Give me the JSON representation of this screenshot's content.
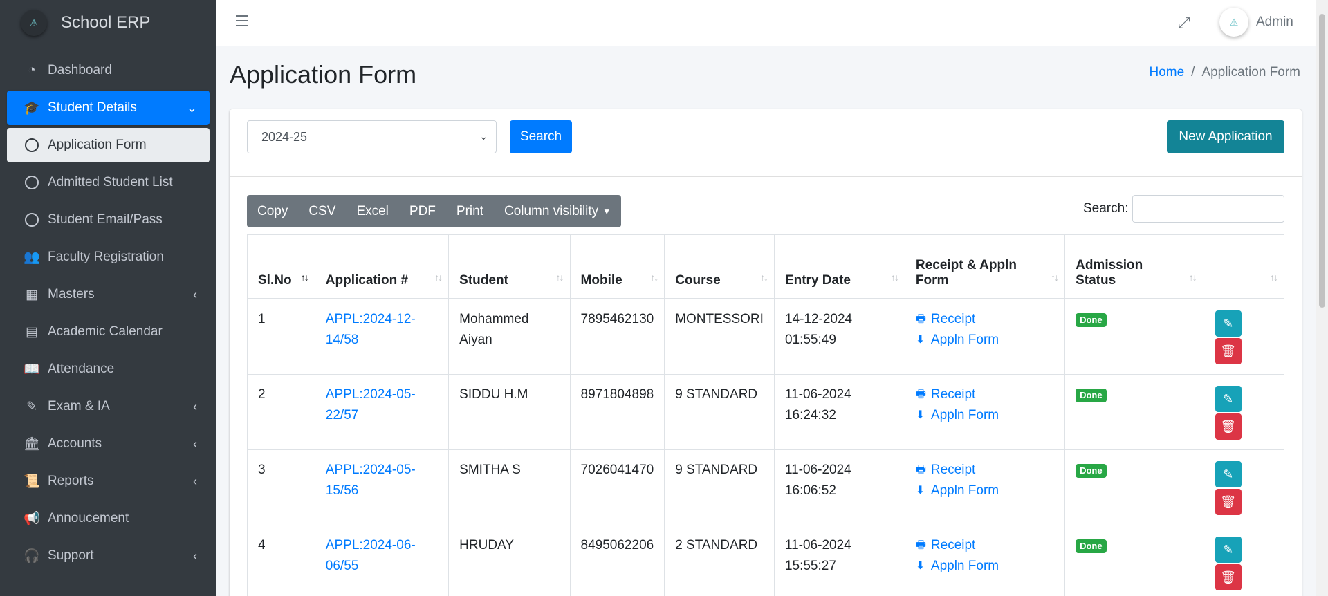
{
  "brand": {
    "name": "School ERP",
    "logo_icon": "school-logo-icon"
  },
  "sidebar": {
    "items": [
      {
        "label": "Dashboard",
        "icon": "dashboard-icon",
        "glyph": "◔",
        "state": "normal",
        "arrow": ""
      },
      {
        "label": "Student Details",
        "icon": "graduation-cap-icon",
        "glyph": "🎓",
        "state": "active",
        "arrow": "⌄"
      },
      {
        "label": "Application Form",
        "icon": "circle-icon",
        "glyph": "",
        "state": "sub-active",
        "arrow": ""
      },
      {
        "label": "Admitted Student List",
        "icon": "circle-icon",
        "glyph": "",
        "state": "sub",
        "arrow": ""
      },
      {
        "label": "Student Email/Pass",
        "icon": "circle-icon",
        "glyph": "",
        "state": "sub",
        "arrow": ""
      },
      {
        "label": "Faculty Registration",
        "icon": "users-icon",
        "glyph": "👥",
        "state": "normal",
        "arrow": ""
      },
      {
        "label": "Masters",
        "icon": "grid-icon",
        "glyph": "▦",
        "state": "normal",
        "arrow": "‹"
      },
      {
        "label": "Academic Calendar",
        "icon": "calendar-icon",
        "glyph": "▤",
        "state": "normal",
        "arrow": ""
      },
      {
        "label": "Attendance",
        "icon": "book-icon",
        "glyph": "📖",
        "state": "normal",
        "arrow": ""
      },
      {
        "label": "Exam & IA",
        "icon": "pencil-icon",
        "glyph": "✎",
        "state": "normal",
        "arrow": "‹"
      },
      {
        "label": "Accounts",
        "icon": "bank-icon",
        "glyph": "🏛",
        "state": "normal",
        "arrow": "‹"
      },
      {
        "label": "Reports",
        "icon": "scroll-icon",
        "glyph": "📜",
        "state": "normal",
        "arrow": "‹"
      },
      {
        "label": "Annoucement",
        "icon": "megaphone-icon",
        "glyph": "📢",
        "state": "normal",
        "arrow": ""
      },
      {
        "label": "Support",
        "icon": "headset-icon",
        "glyph": "🎧",
        "state": "normal",
        "arrow": "‹"
      }
    ]
  },
  "topbar": {
    "user_name": "Admin"
  },
  "page": {
    "title": "Application Form",
    "breadcrumb": {
      "home": "Home",
      "current": "Application Form"
    }
  },
  "filters": {
    "year_value": "2024-25",
    "search_button": "Search",
    "new_button": "New Application"
  },
  "table_tools": {
    "buttons": [
      "Copy",
      "CSV",
      "Excel",
      "PDF",
      "Print",
      "Column visibility"
    ],
    "search_label": "Search:"
  },
  "table": {
    "headers": [
      "Sl.No",
      "Application #",
      "Student",
      "Mobile",
      "Course",
      "Entry Date",
      "Receipt & Appln Form",
      "Admission Status",
      ""
    ],
    "rows": [
      {
        "sl": "1",
        "app_no": "APPL:2024-12-14/58",
        "app_line1": "APPL:2024-12-",
        "app_line2": "14/58",
        "student": "Mohammed Aiyan",
        "mobile": "7895462130",
        "course": "MONTESSORI",
        "date": "14-12-2024",
        "time": "01:55:49",
        "receipt": "Receipt",
        "form": "Appln Form",
        "status": "Done"
      },
      {
        "sl": "2",
        "app_no": "APPL:2024-05-22/57",
        "app_line1": "APPL:2024-05-",
        "app_line2": "22/57",
        "student": "SIDDU H.M",
        "mobile": "8971804898",
        "course": "9 STANDARD",
        "date": "11-06-2024",
        "time": "16:24:32",
        "receipt": "Receipt",
        "form": "Appln Form",
        "status": "Done"
      },
      {
        "sl": "3",
        "app_no": "APPL:2024-05-15/56",
        "app_line1": "APPL:2024-05-",
        "app_line2": "15/56",
        "student": "SMITHA S",
        "mobile": "7026041470",
        "course": "9 STANDARD",
        "date": "11-06-2024",
        "time": "16:06:52",
        "receipt": "Receipt",
        "form": "Appln Form",
        "status": "Done"
      },
      {
        "sl": "4",
        "app_no": "APPL:2024-06-06/55",
        "app_line1": "APPL:2024-06-",
        "app_line2": "06/55",
        "student": "HRUDAY",
        "mobile": "8495062206",
        "course": "2 STANDARD",
        "date": "11-06-2024",
        "time": "15:55:27",
        "receipt": "Receipt",
        "form": "Appln Form",
        "status": "Done"
      }
    ]
  },
  "colors": {
    "primary": "#007bff",
    "info": "#17a2b8",
    "danger": "#dc3545",
    "success": "#28a745",
    "sidebar": "#343a40"
  }
}
